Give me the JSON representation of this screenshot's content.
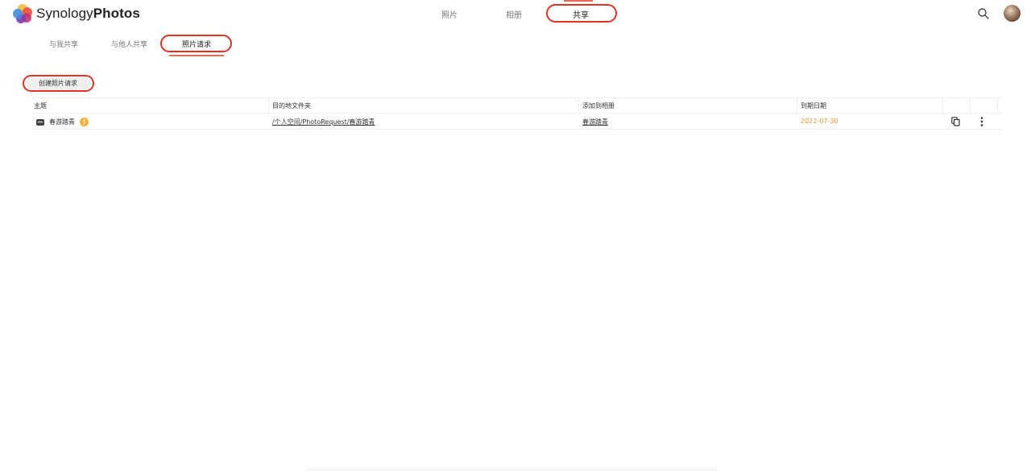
{
  "app": {
    "brand_light": "Synology",
    "brand_bold": "Photos"
  },
  "nav": {
    "items": [
      {
        "label": "照片"
      },
      {
        "label": "相册"
      },
      {
        "label": "共享",
        "active": true
      }
    ]
  },
  "header_icons": {
    "search": "search-icon",
    "avatar": "user-avatar"
  },
  "subnav": {
    "items": [
      {
        "label": "与我共享"
      },
      {
        "label": "与他人共享"
      },
      {
        "label": "照片请求",
        "active": true
      }
    ]
  },
  "toolbar": {
    "create_label": "创建照片请求"
  },
  "table": {
    "columns": [
      "主题",
      "目的地文件夹",
      "添加到相册",
      "到期日期"
    ],
    "rows": [
      {
        "subject": "春游踏青",
        "status_icon": "warning-icon",
        "destination": "/个人空间/PhotoRequest/春游踏青",
        "album": "春游踏青",
        "expiry": "2022-07-30"
      }
    ]
  },
  "colors": {
    "accent": "#e86a55",
    "highlight": "#e03221",
    "date": "#e8912a",
    "warning": "#f3b23a"
  }
}
